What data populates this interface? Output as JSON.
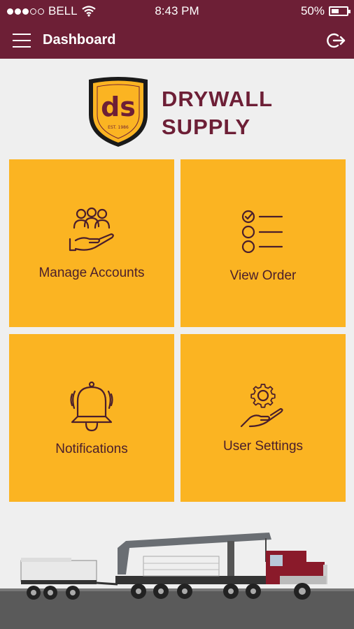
{
  "status_bar": {
    "carrier": "BELL",
    "time": "8:43 PM",
    "battery": "50%",
    "battery_level": 0.5,
    "signal_bars": 3
  },
  "app_bar": {
    "title": "Dashboard",
    "menu_icon": "hamburger-menu-icon",
    "logout_icon": "logout-icon"
  },
  "brand": {
    "line1": "DRYWALL",
    "line2": "SUPPLY",
    "logo_text": "ds",
    "logo_est": "EST. 1986"
  },
  "tiles": [
    {
      "label": "Manage Accounts",
      "icon": "manage-accounts-icon"
    },
    {
      "label": "View Order",
      "icon": "checklist-icon"
    },
    {
      "label": "Notifications",
      "icon": "bell-icon"
    },
    {
      "label": "User Settings",
      "icon": "settings-hand-icon"
    }
  ],
  "colors": {
    "primary": "#6d1f36",
    "tile": "#fbb422",
    "tile_text": "#4a1e2c",
    "background": "#efefef"
  }
}
